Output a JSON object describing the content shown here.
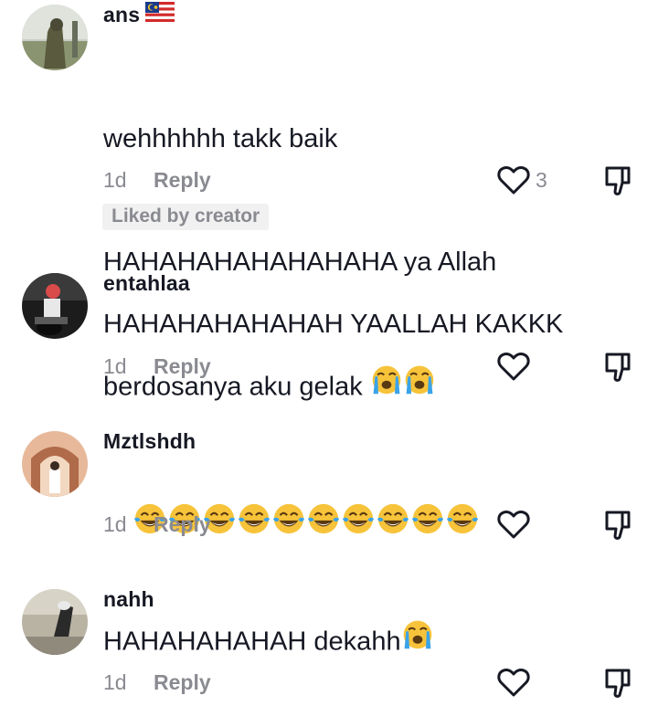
{
  "comments": [
    {
      "username": "ans",
      "flag": "malaysia-flag",
      "lines": [
        "wehhhhhh takk baik",
        "HAHAHAHAHAHAHAHA ya Allah",
        "berdosanya aku gelak"
      ],
      "line_emoji": "loudly-crying-face",
      "time": "1d",
      "reply": "Reply",
      "likes": "3",
      "badge": "Liked by creator"
    },
    {
      "username": "entahlaa",
      "text": "HAHAHAHAHAHAH YAALLAH KAKKK",
      "time": "1d",
      "reply": "Reply"
    },
    {
      "username": "Mztlshdh",
      "emoji_name": "face-with-tears-of-joy",
      "emoji_count": 10,
      "time": "1d",
      "reply": "Reply"
    },
    {
      "username": "nahh",
      "text": "HAHAHAHAHAH dekahh",
      "text_emoji": "loudly-crying-face",
      "time": "1d",
      "reply": "Reply"
    }
  ],
  "colors": {
    "text": "#161823",
    "muted": "#8a8b91",
    "badge_bg": "#f1f1f2",
    "emoji_yellow": "#f7c33a",
    "tear_blue": "#3aa3e8"
  }
}
